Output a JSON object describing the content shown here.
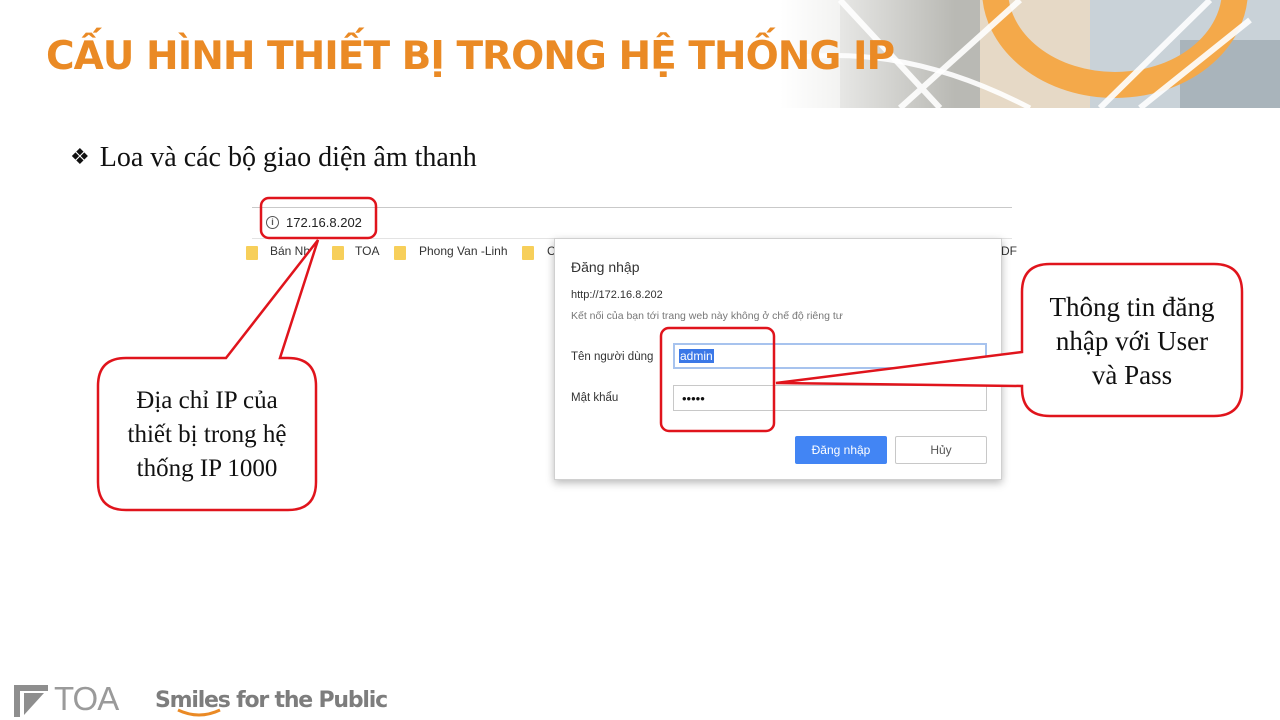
{
  "slide": {
    "title": "CẤU HÌNH THIẾT BỊ TRONG HỆ THỐNG IP",
    "bullet_symbol": "❖",
    "bullet_text": "Loa và các bộ giao diện âm thanh"
  },
  "browser": {
    "url": "172.16.8.202",
    "bookmarks": [
      {
        "label": "Bán Nh"
      },
      {
        "label": "TOA"
      },
      {
        "label": "Phong Van -Linh"
      },
      {
        "label": "C"
      },
      {
        "label": "DF"
      }
    ]
  },
  "dialog": {
    "title": "Đăng nhập",
    "url": "http://172.16.8.202",
    "note": "Kết nối của bạn tới trang web này không ở chế độ riêng tư",
    "username_label": "Tên người dùng",
    "username_value": "admin",
    "password_label": "Mật khẩu",
    "password_mask": "•••••",
    "login_button": "Đăng nhập",
    "cancel_button": "Hủy"
  },
  "callouts": {
    "ip_address": [
      "Địa chỉ IP của",
      "thiết bị trong hệ",
      "thống IP 1000"
    ],
    "login_info": [
      "Thông tin đăng",
      "nhập với User",
      "và Pass"
    ]
  },
  "footer": {
    "brand": "TOA",
    "tagline": "Smiles for the Public"
  },
  "colors": {
    "title_orange": "#ea8a25",
    "callout_red": "#e0141c",
    "button_blue": "#4285f4"
  }
}
